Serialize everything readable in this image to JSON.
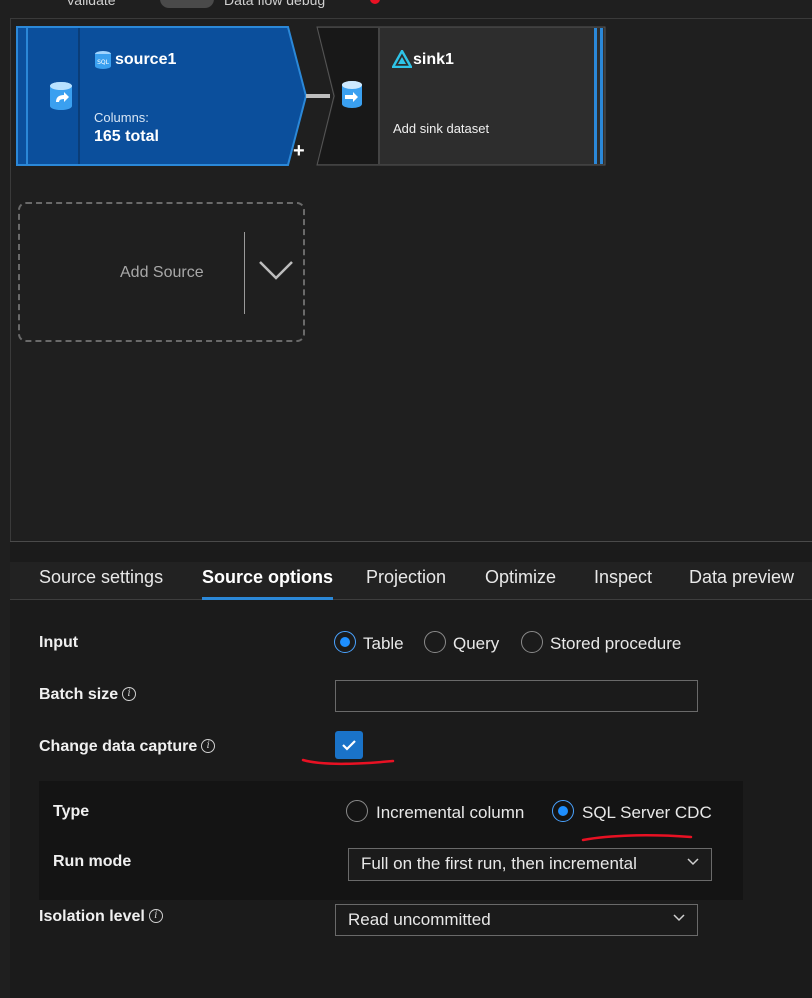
{
  "toolbar": {
    "validate_label": "Validate",
    "debug_label": "Data flow debug"
  },
  "canvas": {
    "source_node": {
      "name": "source1",
      "columns_label": "Columns:",
      "columns_value": "165 total",
      "icon": "sql-database-icon"
    },
    "sink_node": {
      "name": "sink1",
      "subtitle": "Add sink dataset",
      "icon": "database-import-icon"
    },
    "add_source_label": "Add Source"
  },
  "tabs": [
    {
      "label": "Source settings",
      "active": false
    },
    {
      "label": "Source options",
      "active": true
    },
    {
      "label": "Projection",
      "active": false
    },
    {
      "label": "Optimize",
      "active": false
    },
    {
      "label": "Inspect",
      "active": false
    },
    {
      "label": "Data preview",
      "active": false
    }
  ],
  "form": {
    "input": {
      "label": "Input",
      "options": [
        "Table",
        "Query",
        "Stored procedure"
      ],
      "selected": "Table"
    },
    "batch_size": {
      "label": "Batch size",
      "value": ""
    },
    "change_data_capture": {
      "label": "Change data capture",
      "checked": true
    },
    "type": {
      "label": "Type",
      "options": [
        "Incremental column",
        "SQL Server CDC"
      ],
      "selected": "SQL Server CDC"
    },
    "run_mode": {
      "label": "Run mode",
      "value": "Full on the first run, then incremental"
    },
    "isolation_level": {
      "label": "Isolation level",
      "value": "Read uncommitted"
    }
  },
  "colors": {
    "accent": "#1a73c8",
    "source_node": "#0b4f9c",
    "annotation": "#e81123"
  }
}
